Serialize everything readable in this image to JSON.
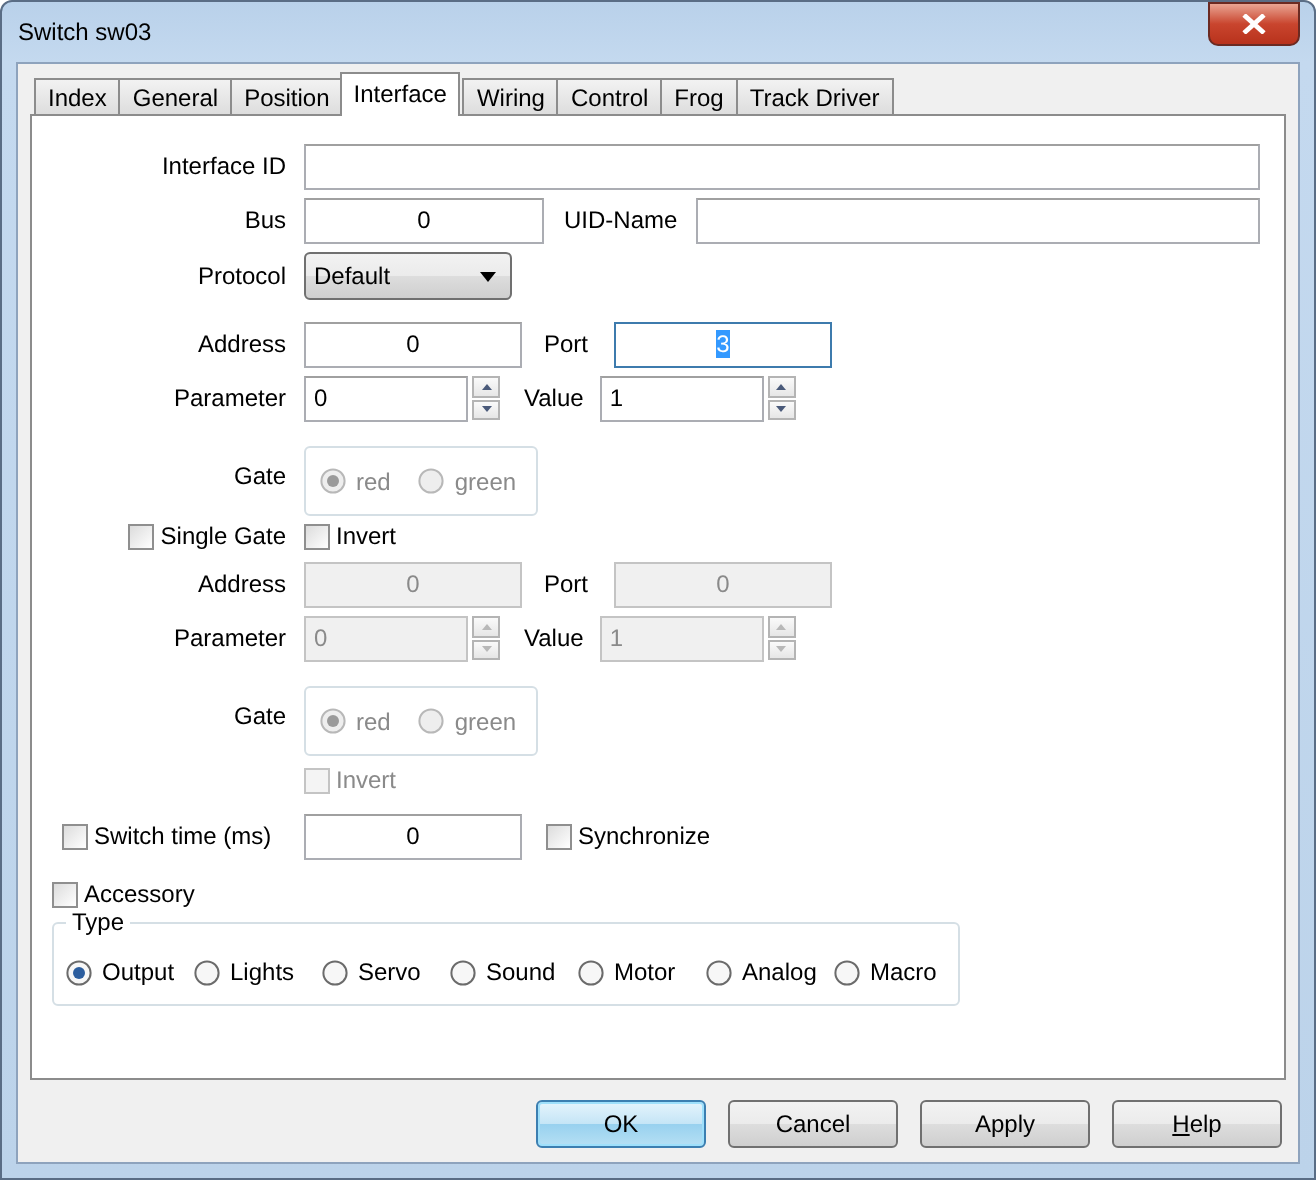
{
  "window": {
    "title": "Switch sw03"
  },
  "tabs": [
    {
      "label": "Index",
      "selected": false
    },
    {
      "label": "General",
      "selected": false
    },
    {
      "label": "Position",
      "selected": false
    },
    {
      "label": "Interface",
      "selected": true
    },
    {
      "label": "Wiring",
      "selected": false
    },
    {
      "label": "Control",
      "selected": false
    },
    {
      "label": "Frog",
      "selected": false
    },
    {
      "label": "Track Driver",
      "selected": false
    }
  ],
  "interface_id": {
    "label": "Interface ID"
  },
  "bus": {
    "label": "Bus",
    "value": "0"
  },
  "uid_name": {
    "label": "UID-Name"
  },
  "protocol": {
    "label": "Protocol",
    "value": "Default"
  },
  "primary": {
    "disabled": false,
    "address": {
      "label": "Address",
      "value": "0"
    },
    "port": {
      "label": "Port",
      "value": "3",
      "text_selected": true
    },
    "parameter": {
      "label": "Parameter",
      "value": "0"
    },
    "value": {
      "label": "Value",
      "value": "1"
    },
    "gate": {
      "label": "Gate",
      "disabled": true,
      "options": [
        {
          "label": "red",
          "selected": true
        },
        {
          "label": "green",
          "selected": false
        }
      ]
    }
  },
  "single_gate": {
    "label": "Single Gate",
    "checked": false
  },
  "invert": {
    "label": "Invert",
    "checked": false
  },
  "secondary": {
    "disabled": true,
    "address": {
      "label": "Address",
      "value": "0"
    },
    "port": {
      "label": "Port",
      "value": "0",
      "text_selected": false
    },
    "parameter": {
      "label": "Parameter",
      "value": "0"
    },
    "value": {
      "label": "Value",
      "value": "1"
    },
    "gate": {
      "label": "Gate",
      "disabled": true,
      "options": [
        {
          "label": "red",
          "selected": true
        },
        {
          "label": "green",
          "selected": false
        }
      ]
    },
    "invert": {
      "label": "Invert",
      "checked": false
    }
  },
  "switch_time": {
    "label": "Switch time (ms)",
    "checked": false,
    "value": "0"
  },
  "synchronize": {
    "label": "Synchronize",
    "checked": false
  },
  "accessory": {
    "label": "Accessory",
    "checked": false
  },
  "type": {
    "label": "Type",
    "options": [
      {
        "label": "Output",
        "selected": true
      },
      {
        "label": "Lights",
        "selected": false
      },
      {
        "label": "Servo",
        "selected": false
      },
      {
        "label": "Sound",
        "selected": false
      },
      {
        "label": "Motor",
        "selected": false
      },
      {
        "label": "Analog",
        "selected": false
      },
      {
        "label": "Macro",
        "selected": false
      }
    ]
  },
  "buttons": [
    {
      "label": "OK",
      "default": true,
      "mnemonic": false
    },
    {
      "label": "Cancel",
      "default": false,
      "mnemonic": false
    },
    {
      "label": "Apply",
      "default": false,
      "mnemonic": false
    },
    {
      "label": "Help",
      "default": false,
      "mnemonic": true
    }
  ]
}
